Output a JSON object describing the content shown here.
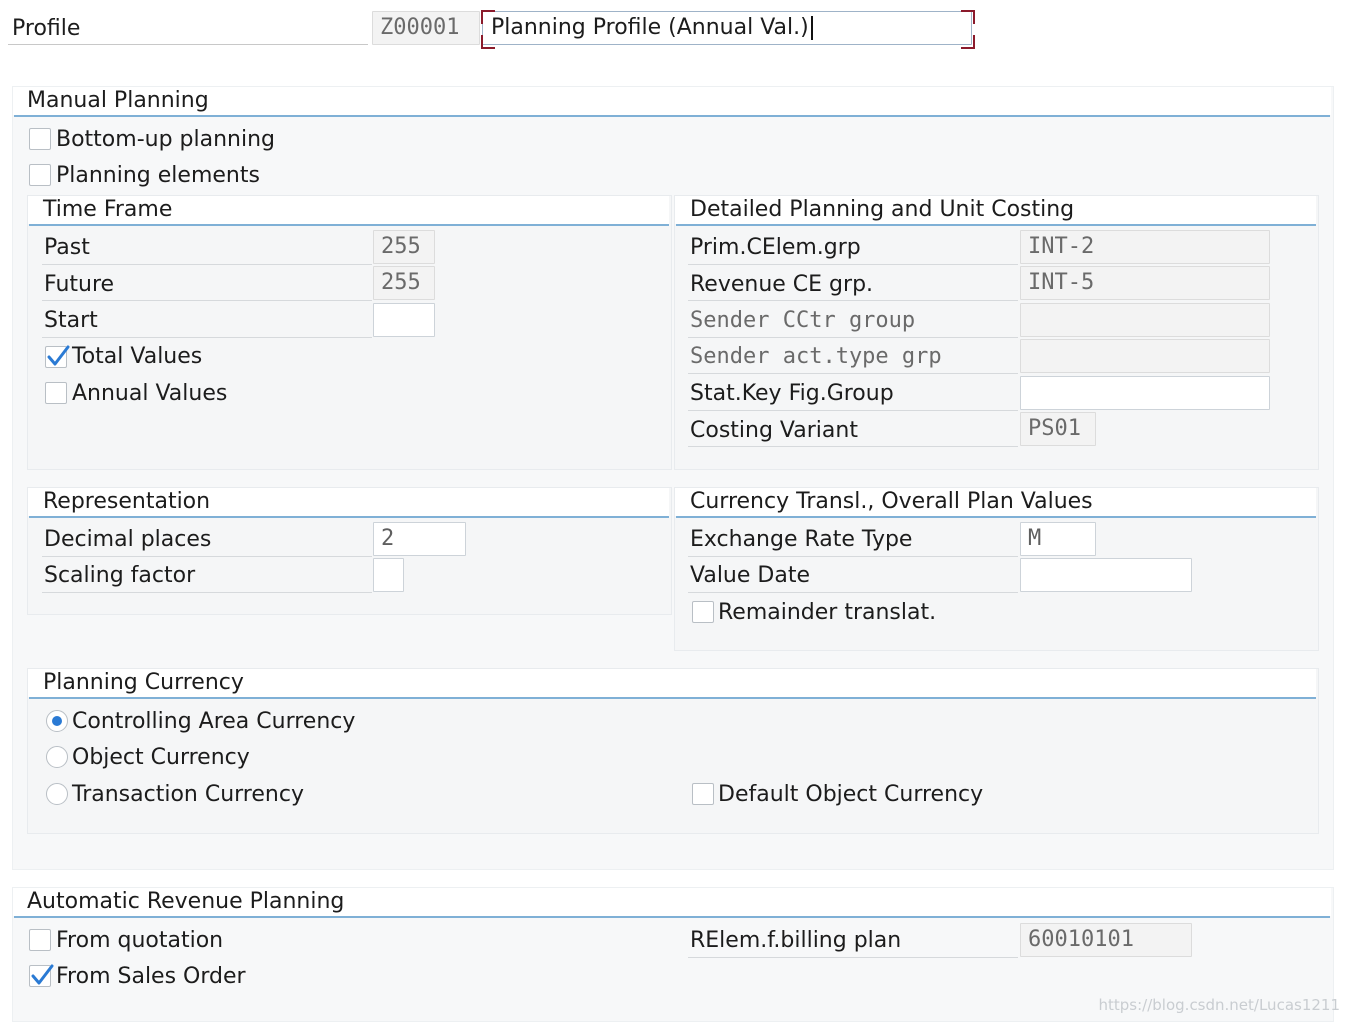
{
  "header": {
    "profile_label": "Profile",
    "profile_code": "Z00001",
    "profile_description": "Planning Profile (Annual Val.)"
  },
  "manual_planning": {
    "title": "Manual Planning",
    "bottom_up": {
      "label": "Bottom-up planning",
      "checked": false
    },
    "planning_elements": {
      "label": "Planning elements",
      "checked": false
    },
    "time_frame": {
      "title": "Time Frame",
      "past": {
        "label": "Past",
        "value": "255"
      },
      "future": {
        "label": "Future",
        "value": "255"
      },
      "start": {
        "label": "Start",
        "value": ""
      },
      "total_values": {
        "label": "Total Values",
        "checked": true
      },
      "annual_values": {
        "label": "Annual Values",
        "checked": false
      }
    },
    "detailed": {
      "title": "Detailed Planning and Unit Costing",
      "prim_celem": {
        "label": "Prim.CElem.grp",
        "value": "INT-2"
      },
      "revenue_ce": {
        "label": "Revenue CE grp.",
        "value": "INT-5"
      },
      "sender_cctr": {
        "label": "Sender CCtr group",
        "value": ""
      },
      "sender_act": {
        "label": "Sender act.type grp",
        "value": ""
      },
      "stat_key": {
        "label": "Stat.Key Fig.Group",
        "value": ""
      },
      "costing_variant": {
        "label": "Costing Variant",
        "value": "PS01"
      }
    },
    "representation": {
      "title": "Representation",
      "decimal_places": {
        "label": "Decimal places",
        "value": "2"
      },
      "scaling_factor": {
        "label": "Scaling factor",
        "value": ""
      }
    },
    "currency_transl": {
      "title": "Currency Transl., Overall Plan Values",
      "exchange_rate": {
        "label": "Exchange Rate Type",
        "value": "M"
      },
      "value_date": {
        "label": "Value Date",
        "value": ""
      },
      "remainder": {
        "label": "Remainder translat.",
        "checked": false
      }
    },
    "planning_currency": {
      "title": "Planning Currency",
      "options": [
        {
          "label": "Controlling Area Currency",
          "selected": true
        },
        {
          "label": "Object Currency",
          "selected": false
        },
        {
          "label": "Transaction Currency",
          "selected": false
        }
      ],
      "default_object_currency": {
        "label": "Default Object Currency",
        "checked": false
      }
    }
  },
  "automatic_revenue": {
    "title": "Automatic Revenue Planning",
    "from_quotation": {
      "label": "From quotation",
      "checked": false
    },
    "from_sales_order": {
      "label": "From Sales Order",
      "checked": true
    },
    "billing_plan": {
      "label": "RElem.f.billing plan",
      "value": "60010101"
    }
  },
  "watermark": "https://blog.csdn.net/Lucas1211",
  "colors": {
    "accent_line": "#7fb0d6",
    "checkmark": "#2a7ad4",
    "focus_corner": "#8b1a2b"
  }
}
